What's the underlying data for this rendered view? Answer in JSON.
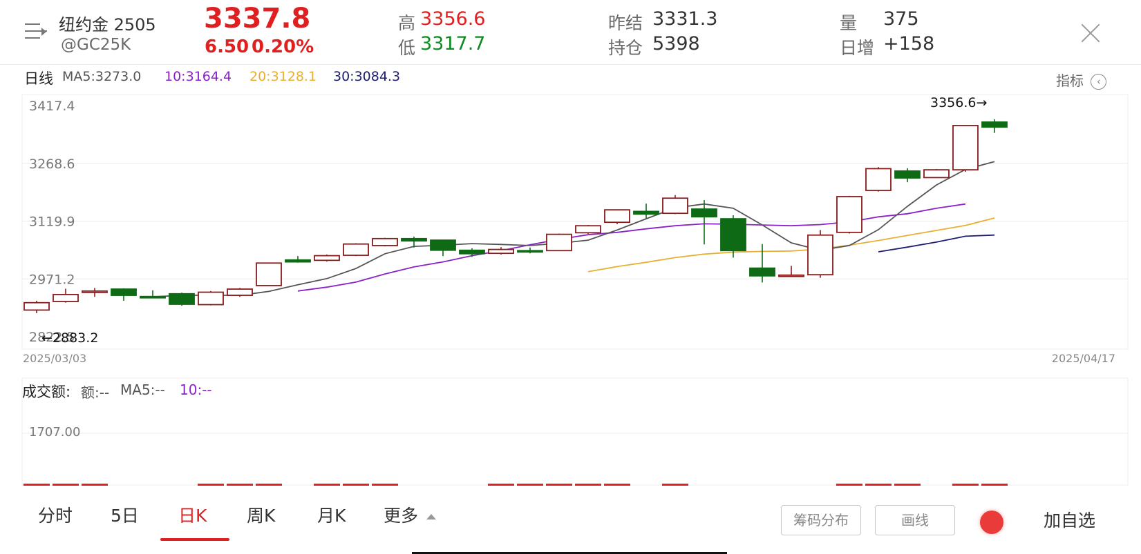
{
  "header": {
    "name": "纽约金 2505",
    "code": "@GC25K",
    "price": "3337.8",
    "change": "6.50",
    "change_pct": "0.20%",
    "high_label": "高",
    "high": "3356.6",
    "low_label": "低",
    "low": "3317.7",
    "prev_settle_label": "昨结",
    "prev_settle": "3331.3",
    "open_interest_label": "持仓",
    "open_interest": "5398",
    "volume_label": "量",
    "volume": "375",
    "daily_increase_label": "日增",
    "daily_increase": "+158"
  },
  "chart_bar": {
    "period_label": "日线",
    "ma5": "MA5:3273.0",
    "ma10": "10:3164.4",
    "ma20": "20:3128.1",
    "ma30": "30:3084.3",
    "indicator_label": "指标"
  },
  "volume_bar": {
    "title": "成交额:",
    "amount": "额:--",
    "ma5": "MA5:--",
    "ma10": "10:--",
    "level_label": "1707.00"
  },
  "tabs": [
    "分时",
    "5日",
    "日K",
    "周K",
    "月K",
    "更多"
  ],
  "active_tab": "日K",
  "buttons": {
    "chip": "筹码分布",
    "draw": "画线",
    "add": "加自选"
  },
  "colors": {
    "up": "#e02020",
    "down": "#0a8a1f",
    "candle_up": "#8b1a1a",
    "candle_down": "#0e6a14",
    "ma5": "#555555",
    "ma10": "#8a22c9",
    "ma20": "#e8b030",
    "ma30": "#1c1c70"
  },
  "chart_data": {
    "type": "candlestick",
    "x_start": "2025/03/03",
    "x_end": "2025/04/17",
    "y_ticks": [
      "3417.4",
      "3268.6",
      "3119.9",
      "2971.2",
      "2822.5"
    ],
    "ylim": [
      2822.5,
      3417.4
    ],
    "max_label": "3356.6→",
    "min_label": "←2883.2",
    "candles": [
      {
        "o": 2891,
        "c": 2910,
        "h": 2915,
        "l": 2883
      },
      {
        "o": 2913,
        "c": 2931,
        "h": 2946,
        "l": 2910
      },
      {
        "o": 2938,
        "c": 2940,
        "h": 2948,
        "l": 2925
      },
      {
        "o": 2945,
        "c": 2929,
        "h": 2947,
        "l": 2915
      },
      {
        "o": 2926,
        "c": 2925,
        "h": 2942,
        "l": 2923
      },
      {
        "o": 2933,
        "c": 2906,
        "h": 2936,
        "l": 2902
      },
      {
        "o": 2905,
        "c": 2937,
        "h": 2940,
        "l": 2903
      },
      {
        "o": 2929,
        "c": 2945,
        "h": 2948,
        "l": 2925
      },
      {
        "o": 2954,
        "c": 3012,
        "h": 3013,
        "l": 2953
      },
      {
        "o": 3020,
        "c": 3015,
        "h": 3030,
        "l": 3013
      },
      {
        "o": 3019,
        "c": 3031,
        "h": 3034,
        "l": 3016
      },
      {
        "o": 3032,
        "c": 3061,
        "h": 3063,
        "l": 3030
      },
      {
        "o": 3057,
        "c": 3075,
        "h": 3077,
        "l": 3055
      },
      {
        "o": 3075,
        "c": 3069,
        "h": 3080,
        "l": 3052
      },
      {
        "o": 3071,
        "c": 3045,
        "h": 3072,
        "l": 3030
      },
      {
        "o": 3045,
        "c": 3036,
        "h": 3050,
        "l": 3028
      },
      {
        "o": 3037,
        "c": 3047,
        "h": 3053,
        "l": 3034
      },
      {
        "o": 3044,
        "c": 3042,
        "h": 3052,
        "l": 3037
      },
      {
        "o": 3044,
        "c": 3086,
        "h": 3088,
        "l": 3043
      },
      {
        "o": 3090,
        "c": 3108,
        "h": 3110,
        "l": 3087
      },
      {
        "o": 3117,
        "c": 3149,
        "h": 3150,
        "l": 3112
      },
      {
        "o": 3145,
        "c": 3138,
        "h": 3165,
        "l": 3127
      },
      {
        "o": 3140,
        "c": 3179,
        "h": 3187,
        "l": 3138
      },
      {
        "o": 3151,
        "c": 3131,
        "h": 3174,
        "l": 3060
      },
      {
        "o": 3126,
        "c": 3044,
        "h": 3135,
        "l": 3026
      },
      {
        "o": 2999,
        "c": 2979,
        "h": 3061,
        "l": 2962
      },
      {
        "o": 2981,
        "c": 2981,
        "h": 3005,
        "l": 2978
      },
      {
        "o": 2982,
        "c": 3084,
        "h": 3097,
        "l": 2974
      },
      {
        "o": 3091,
        "c": 3183,
        "h": 3185,
        "l": 3088
      },
      {
        "o": 3199,
        "c": 3255,
        "h": 3259,
        "l": 3196
      },
      {
        "o": 3249,
        "c": 3231,
        "h": 3256,
        "l": 3220
      },
      {
        "o": 3232,
        "c": 3252,
        "h": 3254,
        "l": 3231
      },
      {
        "o": 3252,
        "c": 3366,
        "h": 3367,
        "l": 3247
      },
      {
        "o": 3375,
        "c": 3362,
        "h": 3382,
        "l": 3347
      }
    ],
    "ma5_series": [
      null,
      null,
      null,
      null,
      2925,
      2929,
      2929,
      2929,
      2939,
      2956,
      2972,
      2998,
      3036,
      3055,
      3058,
      3062,
      3060,
      3057,
      3063,
      3071,
      3097,
      3126,
      3154,
      3164,
      3153,
      3110,
      3064,
      3045,
      3057,
      3098,
      3158,
      3213,
      3253,
      3273
    ],
    "ma10_series": [
      null,
      null,
      null,
      null,
      null,
      null,
      null,
      null,
      null,
      2940,
      2950,
      2963,
      2984,
      3002,
      3015,
      3031,
      3044,
      3059,
      3073,
      3085,
      3091,
      3100,
      3108,
      3113,
      3112,
      3110,
      3108,
      3111,
      3118,
      3131,
      3139,
      3153,
      3164
    ],
    "ma20_series": [
      null,
      null,
      null,
      null,
      null,
      null,
      null,
      null,
      null,
      null,
      null,
      null,
      null,
      null,
      null,
      null,
      null,
      null,
      null,
      2990,
      3003,
      3014,
      3026,
      3035,
      3040,
      3042,
      3043,
      3048,
      3058,
      3070,
      3083,
      3096,
      3109,
      3128
    ],
    "ma30_series": [
      null,
      null,
      null,
      null,
      null,
      null,
      null,
      null,
      null,
      null,
      null,
      null,
      null,
      null,
      null,
      null,
      null,
      null,
      null,
      null,
      null,
      null,
      null,
      null,
      null,
      null,
      null,
      null,
      null,
      3041,
      3053,
      3066,
      3081,
      3084
    ],
    "volume_bars_up": [
      0,
      1,
      2,
      6,
      7,
      8,
      10,
      11,
      12,
      16,
      17,
      18,
      19,
      20,
      22,
      28,
      29,
      30,
      32,
      33
    ]
  }
}
